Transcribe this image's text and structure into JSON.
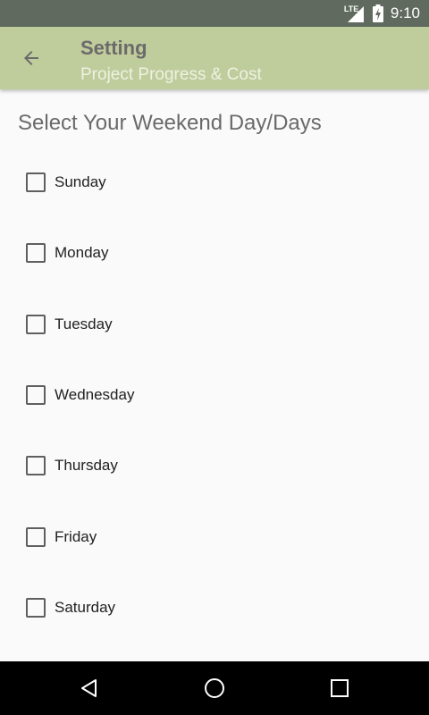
{
  "status_bar": {
    "network": "LTE",
    "time": "9:10",
    "icons": [
      "lte-icon",
      "signal-icon",
      "battery-charging-icon"
    ]
  },
  "app_bar": {
    "title": "Setting",
    "subtitle": "Project Progress & Cost",
    "back_icon": "arrow-back-icon",
    "background_color": "#bfcc9c"
  },
  "section": {
    "heading": "Select Your Weekend Day/Days"
  },
  "days": [
    {
      "label": "Sunday",
      "checked": false
    },
    {
      "label": "Monday",
      "checked": false
    },
    {
      "label": "Tuesday",
      "checked": false
    },
    {
      "label": "Wednesday",
      "checked": false
    },
    {
      "label": "Thursday",
      "checked": false
    },
    {
      "label": "Friday",
      "checked": false
    },
    {
      "label": "Saturday",
      "checked": false
    }
  ],
  "nav_bar": {
    "buttons": [
      "back-triangle-icon",
      "home-circle-icon",
      "recents-square-icon"
    ]
  }
}
